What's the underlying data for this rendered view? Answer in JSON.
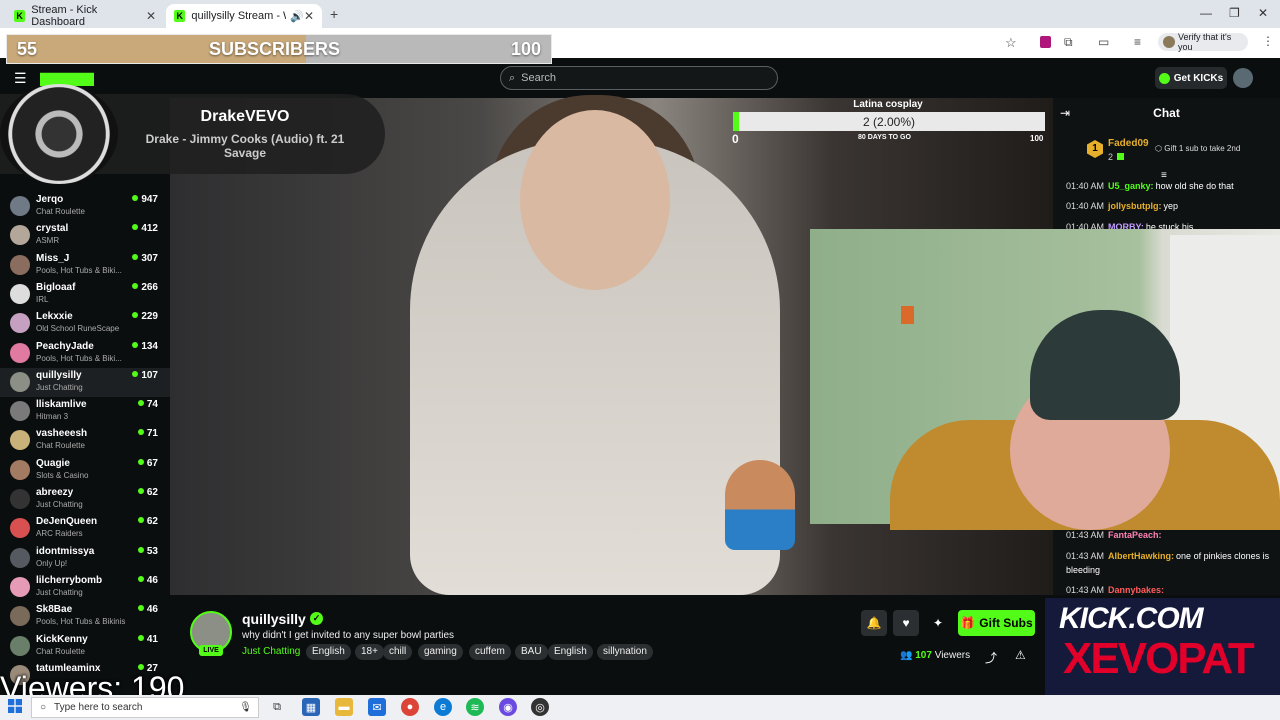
{
  "browser": {
    "tabs": [
      {
        "title": "Stream - Kick Dashboard"
      },
      {
        "title": "quillysilly Stream - Watch Li"
      }
    ],
    "verify_label": "Verify that it's you"
  },
  "overlay": {
    "subscribers": {
      "current": "55",
      "label": "SUBSCRIBERS",
      "goal": "100",
      "progress_fraction": 0.55
    },
    "now_playing": {
      "artist": "DrakeVEVO",
      "track": "Drake - Jimmy Cooks (Audio) ft. 21 Savage"
    },
    "goal": {
      "title": "Latina cosplay",
      "label": "2 (2.00%)",
      "min": "0",
      "max": "100",
      "days": "80 DAYS TO GO",
      "progress_fraction": 0.02
    },
    "viewers_text": "Viewers: 190",
    "logo_line1": "KICK.COM",
    "logo_line2": "XEVOPAT"
  },
  "header": {
    "search_placeholder": "Search",
    "get_kicks_label": "Get KICKs"
  },
  "sidebar": {
    "channels": [
      {
        "name": "Jerqo",
        "category": "Chat Roulette",
        "viewers": "947",
        "color": "#6f7a86"
      },
      {
        "name": "crystal",
        "category": "ASMR",
        "viewers": "412",
        "color": "#b3a79a"
      },
      {
        "name": "Miss_J",
        "category": "Pools, Hot Tubs & Biki...",
        "viewers": "307",
        "color": "#8a6d5e"
      },
      {
        "name": "Bigloaaf",
        "category": "IRL",
        "viewers": "266",
        "color": "#dddddd"
      },
      {
        "name": "Lekxxie",
        "category": "Old School RuneScape",
        "viewers": "229",
        "color": "#c5a0c0"
      },
      {
        "name": "PeachyJade",
        "category": "Pools, Hot Tubs & Biki...",
        "viewers": "134",
        "color": "#e07aa0"
      },
      {
        "name": "quillysilly",
        "category": "Just Chatting",
        "viewers": "107",
        "color": "#8b8f86"
      },
      {
        "name": "lliskamlive",
        "category": "Hitman 3",
        "viewers": "74",
        "color": "#7a7a7a"
      },
      {
        "name": "vasheeesh",
        "category": "Chat Roulette",
        "viewers": "71",
        "color": "#c9b27a"
      },
      {
        "name": "Quagie",
        "category": "Slots & Casino",
        "viewers": "67",
        "color": "#a37b63"
      },
      {
        "name": "abreezy",
        "category": "Just Chatting",
        "viewers": "62",
        "color": "#333333"
      },
      {
        "name": "DeJenQueen",
        "category": "ARC Raiders",
        "viewers": "62",
        "color": "#d95050"
      },
      {
        "name": "idontmissya",
        "category": "Only Up!",
        "viewers": "53",
        "color": "#555a60"
      },
      {
        "name": "lilcherrybomb",
        "category": "Just Chatting",
        "viewers": "46",
        "color": "#e59ab5"
      },
      {
        "name": "Sk8Bae",
        "category": "Pools, Hot Tubs & Bikinis",
        "viewers": "46",
        "color": "#7a6a5a"
      },
      {
        "name": "KickKenny",
        "category": "Chat Roulette",
        "viewers": "41",
        "color": "#6a7f6a"
      },
      {
        "name": "tatumleaminx",
        "category": "",
        "viewers": "27",
        "color": "#9a8a7a"
      }
    ]
  },
  "chat": {
    "title": "Chat",
    "top_gifter": {
      "name": "Faded09",
      "count": "2",
      "note": "Gift 1 sub to take 2nd"
    },
    "messages": [
      {
        "time": "01:40 AM",
        "user": "U5_ganky:",
        "color": "#53fc18",
        "text": "how old she do that"
      },
      {
        "time": "01:40 AM",
        "user": "jollysbutplg:",
        "color": "#e7b02c",
        "text": "yep"
      },
      {
        "time": "01:40 AM",
        "user": "MORBY:",
        "color": "#c09bff",
        "text": "he stuck his"
      },
      {
        "time": "01:43 AM",
        "user": "FantaPeach:",
        "color": "#ff82b4",
        "text": ""
      },
      {
        "time": "01:43 AM",
        "user": "AlbertHawking:",
        "color": "#e7b02c",
        "text": "one of pinkies clones is bleeding"
      },
      {
        "time": "01:43 AM",
        "user": "Dannybakes:",
        "color": "#ff5c5c",
        "text": ""
      }
    ]
  },
  "stream": {
    "channel": "quillysilly",
    "live_label": "LIVE",
    "title": "why didn't I get invited to any super bowl parties",
    "category": "Just Chatting",
    "tags": [
      "English",
      "18+",
      "chill",
      "gaming",
      "cuffem",
      "BAU",
      "English",
      "sillynation"
    ],
    "viewers": "107",
    "viewers_label": "Viewers",
    "gift_label": "Gift Subs"
  },
  "taskbar": {
    "search_placeholder": "Type here to search"
  },
  "colors": {
    "kick_green": "#53fc18",
    "dark_bg": "#0b0e0f"
  }
}
